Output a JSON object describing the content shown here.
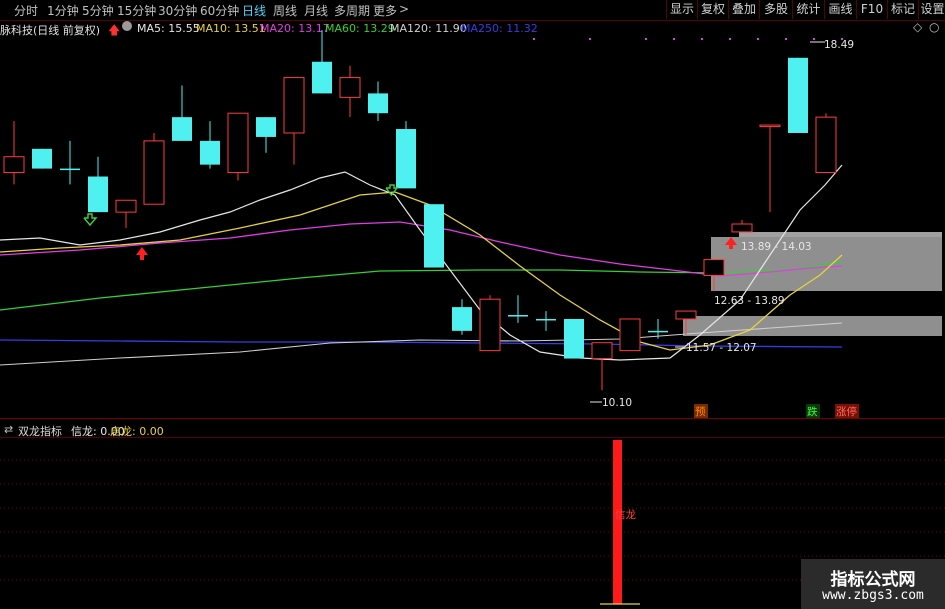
{
  "toolbar": {
    "periods": [
      {
        "label": "分时",
        "active": false
      },
      {
        "label": "1分钟",
        "active": false
      },
      {
        "label": "5分钟",
        "active": false
      },
      {
        "label": "15分钟",
        "active": false
      },
      {
        "label": "30分钟",
        "active": false
      },
      {
        "label": "60分钟",
        "active": false
      },
      {
        "label": "日线",
        "active": true
      },
      {
        "label": "周线",
        "active": false
      },
      {
        "label": "月线",
        "active": false
      },
      {
        "label": "多周期",
        "active": false
      },
      {
        "label": "更多",
        "active": false
      }
    ],
    "more_chevron": ">",
    "buttons": [
      "显示",
      "复权",
      "叠加",
      "多股",
      "统计",
      "画线",
      "F10",
      "标记",
      "设置"
    ]
  },
  "stock_title": "脉科技(日线 前复权)",
  "ma_legend": [
    {
      "label": "MA5: 15.55",
      "color": "#e6e6e6"
    },
    {
      "label": "MA10: 13.51",
      "color": "#e6d23c"
    },
    {
      "label": "MA20: 13.17",
      "color": "#e23ce6"
    },
    {
      "label": "MA60: 13.29",
      "color": "#34d034"
    },
    {
      "label": "MA120: 11.90",
      "color": "#cfcfcf"
    },
    {
      "label": "MA250: 11.32",
      "color": "#3a3ae6"
    }
  ],
  "colors": {
    "up": "#ff3c3c",
    "down": "#4ff0f0",
    "grid": "#7a0000",
    "zone": "#a9a9a9"
  },
  "chart_data": {
    "type": "candlestick",
    "price_range": [
      9.6,
      19.0
    ],
    "candles": [
      {
        "o": 16.0,
        "h": 16.9,
        "l": 15.3,
        "c": 15.6,
        "dir": "up"
      },
      {
        "o": 16.2,
        "h": 16.2,
        "l": 15.7,
        "c": 15.7,
        "dir": "down"
      },
      {
        "o": 15.7,
        "h": 16.4,
        "l": 15.3,
        "c": 15.7,
        "dir": "down"
      },
      {
        "o": 15.5,
        "h": 16.0,
        "l": 14.6,
        "c": 14.6,
        "dir": "down"
      },
      {
        "o": 14.6,
        "h": 14.9,
        "l": 14.2,
        "c": 14.9,
        "dir": "up"
      },
      {
        "o": 14.8,
        "h": 16.6,
        "l": 14.8,
        "c": 16.4,
        "dir": "up"
      },
      {
        "o": 17.0,
        "h": 17.8,
        "l": 16.5,
        "c": 16.4,
        "dir": "down"
      },
      {
        "o": 16.4,
        "h": 16.9,
        "l": 15.7,
        "c": 15.8,
        "dir": "down"
      },
      {
        "o": 15.6,
        "h": 17.1,
        "l": 15.4,
        "c": 17.1,
        "dir": "up"
      },
      {
        "o": 17.0,
        "h": 17.0,
        "l": 16.1,
        "c": 16.5,
        "dir": "down"
      },
      {
        "o": 16.6,
        "h": 18.0,
        "l": 15.8,
        "c": 18.0,
        "dir": "up"
      },
      {
        "o": 18.4,
        "h": 19.2,
        "l": 17.6,
        "c": 17.6,
        "dir": "down"
      },
      {
        "o": 17.5,
        "h": 18.3,
        "l": 17.0,
        "c": 18.0,
        "dir": "up"
      },
      {
        "o": 17.6,
        "h": 17.9,
        "l": 16.9,
        "c": 17.1,
        "dir": "down"
      },
      {
        "o": 16.7,
        "h": 16.9,
        "l": 15.2,
        "c": 15.2,
        "dir": "down"
      },
      {
        "o": 14.8,
        "h": 14.8,
        "l": 13.2,
        "c": 13.2,
        "dir": "down"
      },
      {
        "o": 12.2,
        "h": 12.4,
        "l": 11.5,
        "c": 11.6,
        "dir": "down"
      },
      {
        "o": 11.1,
        "h": 12.5,
        "l": 11.1,
        "c": 12.4,
        "dir": "up"
      },
      {
        "o": 12.0,
        "h": 12.5,
        "l": 11.8,
        "c": 12.0,
        "dir": "down"
      },
      {
        "o": 11.9,
        "h": 12.1,
        "l": 11.6,
        "c": 11.9,
        "dir": "down"
      },
      {
        "o": 11.9,
        "h": 11.9,
        "l": 10.9,
        "c": 10.9,
        "dir": "down"
      },
      {
        "o": 10.9,
        "h": 11.3,
        "l": 10.1,
        "c": 11.3,
        "dir": "up"
      },
      {
        "o": 11.1,
        "h": 11.9,
        "l": 11.1,
        "c": 11.9,
        "dir": "up"
      },
      {
        "o": 11.6,
        "h": 11.9,
        "l": 11.4,
        "c": 11.6,
        "dir": "down"
      },
      {
        "o": 11.9,
        "h": 12.1,
        "l": 11.5,
        "c": 12.1,
        "dir": "up"
      },
      {
        "o": 13.0,
        "h": 13.2,
        "l": 12.6,
        "c": 13.4,
        "dir": "up"
      },
      {
        "o": 14.1,
        "h": 14.4,
        "l": 14.1,
        "c": 14.3,
        "dir": "up"
      },
      {
        "o": 16.8,
        "h": 16.8,
        "l": 14.6,
        "c": 16.8,
        "dir": "up"
      },
      {
        "o": 16.6,
        "h": 18.5,
        "l": 16.6,
        "c": 18.5,
        "dir": "down"
      },
      {
        "o": 17.0,
        "h": 17.1,
        "l": 15.6,
        "c": 15.6,
        "dir": "up"
      }
    ],
    "annotations": {
      "high_label": "18.49",
      "low_label": "10.10",
      "zone_1": "13.89 - 14.03",
      "zone_2": "12.63 - 13.89",
      "zone_3": "11.57 - 12.07",
      "tag_yu": "预",
      "tag_die": "跌",
      "tag_zhangting": "涨停"
    }
  },
  "indicator": {
    "name": "双龙指标",
    "xinlong": "信龙: 0.00",
    "qilong": "启龙: 0.00",
    "signal_label": "信龙"
  },
  "watermark": {
    "title": "指标公式网",
    "url": "www.zbgs3.com"
  }
}
